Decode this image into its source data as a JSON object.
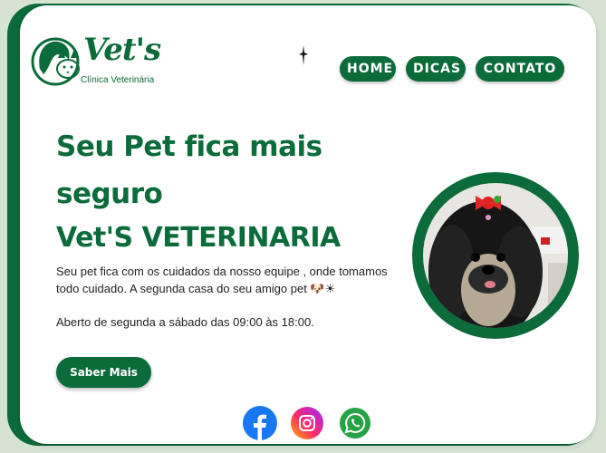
{
  "brand": {
    "name": "Vet's",
    "subtitle": "Clínica Veterinária",
    "logo_icon": "pet-logo-icon"
  },
  "nav": {
    "items": [
      {
        "label": "HOME"
      },
      {
        "label": "DICAS"
      },
      {
        "label": "CONTATO"
      }
    ]
  },
  "hero": {
    "title_line1": "Seu Pet fica mais",
    "title_line2": "seguro",
    "subtitle": "Vet'S VETERINARIA",
    "description": "Seu pet fica com os cuidados da nosso equipe , onde tomamos todo cuidado. A segunda casa do seu amigo pet 🐶☀",
    "hours": "Aberto de segunda a sábado das 09:00 às 18:00.",
    "cta_label": "Saber Mais"
  },
  "social": [
    {
      "icon": "facebook-icon"
    },
    {
      "icon": "instagram-icon"
    },
    {
      "icon": "whatsapp-icon"
    }
  ],
  "colors": {
    "primary": "#0b6b3a",
    "background": "#d6e3d3",
    "card": "#ffffff"
  }
}
